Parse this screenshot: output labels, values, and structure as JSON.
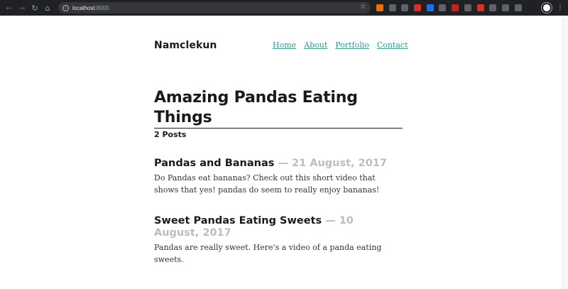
{
  "browser": {
    "url_host": "localhost",
    "url_port": ":8000",
    "extension_colors": [
      "#e8710a",
      "#5f6368",
      "#5f6368",
      "#d93025",
      "#1a73e8",
      "#5f6368",
      "#c5221f",
      "#5f6368",
      "#d93025",
      "#5f6368",
      "#5f6368",
      "#5f6368"
    ]
  },
  "site": {
    "title": "Namclekun",
    "nav": [
      "Home",
      "About",
      "Portfolio",
      "Contact"
    ],
    "link_color": "#2a9d8f"
  },
  "page": {
    "heading": "Amazing Pandas Eating Things",
    "post_count": "2 Posts"
  },
  "posts": [
    {
      "title": "Pandas and Bananas",
      "separator": " — ",
      "date": "21 August, 2017",
      "excerpt": "Do Pandas eat bananas? Check out this short video that shows that yes! pandas do seem to really enjoy bananas!"
    },
    {
      "title": "Sweet Pandas Eating Sweets",
      "separator": " — ",
      "date": "10 August, 2017",
      "excerpt": "Pandas are really sweet. Here's a video of a panda eating sweets."
    }
  ]
}
